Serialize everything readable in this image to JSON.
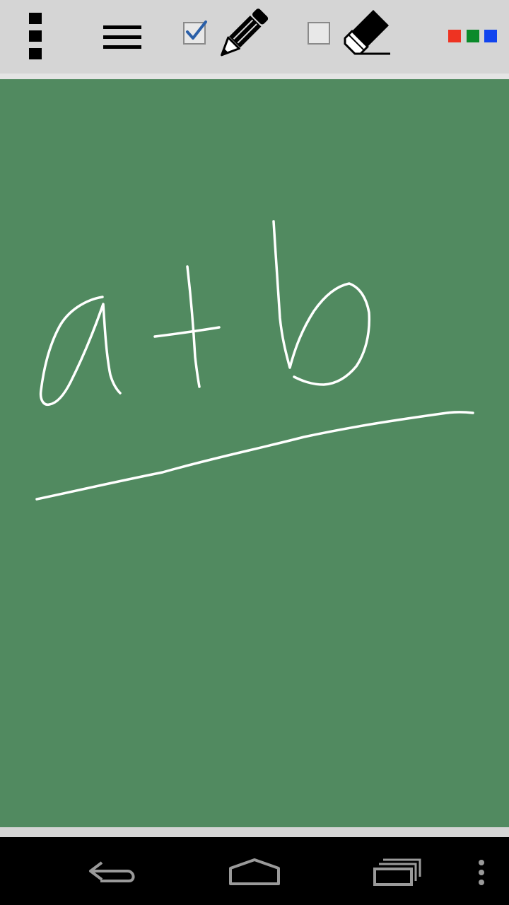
{
  "toolbar": {
    "overflow_icon": "overflow-menu-icon",
    "menu_icon": "hamburger-menu-icon",
    "pen": {
      "icon": "pencil-icon",
      "checked": true
    },
    "eraser": {
      "icon": "eraser-icon",
      "checked": false
    },
    "colors": [
      "#ee3322",
      "#0a8a2a",
      "#1144ee"
    ]
  },
  "canvas": {
    "background": "#518a60",
    "stroke_color": "#ffffff"
  },
  "navbar": {
    "back_icon": "back-icon",
    "home_icon": "home-icon",
    "recents_icon": "recents-icon",
    "menu_icon": "overflow-menu-icon"
  }
}
